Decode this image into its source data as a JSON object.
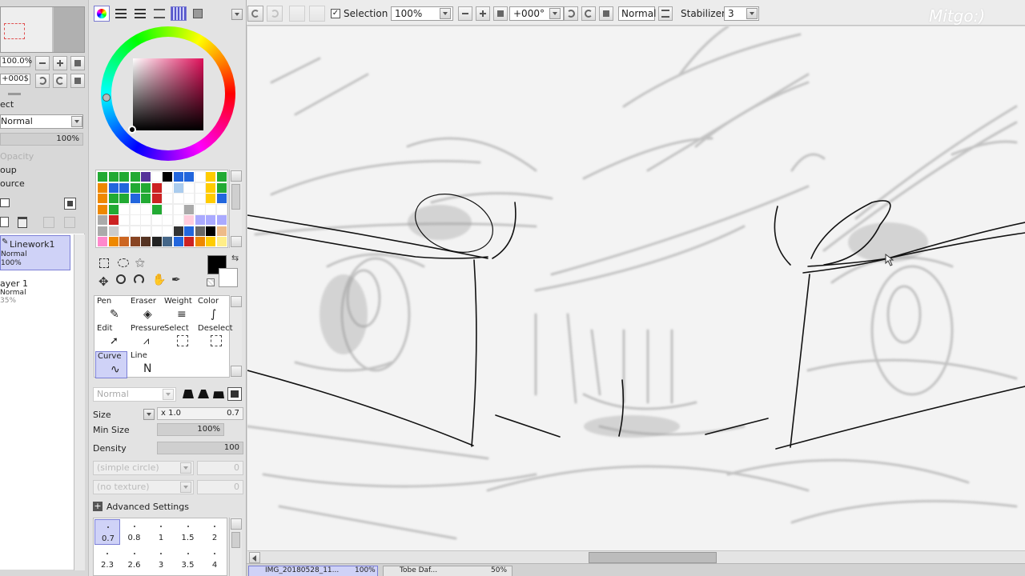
{
  "toolbar": {
    "selection_label": "Selection",
    "zoom_value": "100%",
    "rotation_value": "+000°",
    "blend_mode": "Normal",
    "stabilizer_label": "Stabilizer",
    "stabilizer_value": "3",
    "watermark": "Mitgo:)"
  },
  "navigator": {
    "zoom_value": "100.0%",
    "angle_value": "+000$"
  },
  "layer_panel": {
    "section_label": "ect",
    "blend_mode": "Normal",
    "opacity_value": "100%",
    "opacity_label": "Opacity",
    "group_label": "oup",
    "source_label": "ource",
    "layers": [
      {
        "name": "Linework1",
        "mode": "Normal",
        "opacity": "100%"
      },
      {
        "name": "ayer 1",
        "mode": "Normal",
        "opacity": "35%"
      }
    ]
  },
  "tools": [
    {
      "name": "Pen"
    },
    {
      "name": "Eraser"
    },
    {
      "name": "Weight"
    },
    {
      "name": "Color"
    },
    {
      "name": "Edit"
    },
    {
      "name": "Pressure"
    },
    {
      "name": "Select"
    },
    {
      "name": "Deselect"
    },
    {
      "name": "Curve"
    },
    {
      "name": "Line"
    }
  ],
  "brush": {
    "mode": "Normal",
    "size_label": "Size",
    "size_multiplier": "x 1.0",
    "size_value": "0.7",
    "min_size_label": "Min Size",
    "min_size_value": "100%",
    "min_size_level": 1.0,
    "density_label": "Density",
    "density_value": "100",
    "density_level": 1.0,
    "shape": "(simple circle)",
    "shape_value": "0",
    "texture": "(no texture)",
    "texture_value": "0",
    "advanced_label": "Advanced Settings",
    "presets": [
      "0.7",
      "0.8",
      "1",
      "1.5",
      "2",
      "2.3",
      "2.6",
      "3",
      "3.5",
      "4"
    ]
  },
  "colors": {
    "primary": "#000000",
    "secondary": "#ffffff",
    "swatches": [
      "#22aa33",
      "#22aa33",
      "#22aa33",
      "#22aa33",
      "#553399",
      "#ffffff",
      "#000000",
      "#2266dd",
      "#2266dd",
      "#ffffff",
      "#ffcc00",
      "#22aa33",
      "#ee8800",
      "#2266dd",
      "#2266dd",
      "#22aa33",
      "#22aa33",
      "#cc2222",
      "#ffffff",
      "#aaccee",
      "#ffffff",
      "#ffffff",
      "#ffcc00",
      "#22aa33",
      "#ee8800",
      "#22aa33",
      "#22aa33",
      "#2266dd",
      "#22aa33",
      "#cc2222",
      "#ffffff",
      "#ffffff",
      "#ffffff",
      "#ffffff",
      "#ffcc00",
      "#2266dd",
      "#ee8800",
      "#22aa33",
      "#ffffff",
      "#ffffff",
      "#ffffff",
      "#22aa33",
      "#ffffff",
      "#ffffff",
      "#aaaaaa",
      "#ffffff",
      "#ffffff",
      "#ffffff",
      "#aaaaaa",
      "#cc2222",
      "#ffffff",
      "#ffffff",
      "#ffffff",
      "#ffffff",
      "#ffffff",
      "#ffffff",
      "#ffccdd",
      "#aaaaff",
      "#aaaaff",
      "#aaaaff",
      "#aaaaaa",
      "#cccccc",
      "#ffffff",
      "#ffffff",
      "#ffffff",
      "#ffffff",
      "#ffffff",
      "#333333",
      "#2266dd",
      "#666666",
      "#000000",
      "#eebb88",
      "#ff88cc",
      "#ee8800",
      "#cc6622",
      "#884422",
      "#553322",
      "#222222",
      "#446688",
      "#2266dd",
      "#cc2222",
      "#ee8800",
      "#ffcc00",
      "#ffee88"
    ]
  },
  "status": {
    "doc1": "IMG_20180528_11...",
    "doc1_zoom": "100%",
    "doc2": "Tobe Daf...",
    "doc2_zoom": "50%"
  }
}
